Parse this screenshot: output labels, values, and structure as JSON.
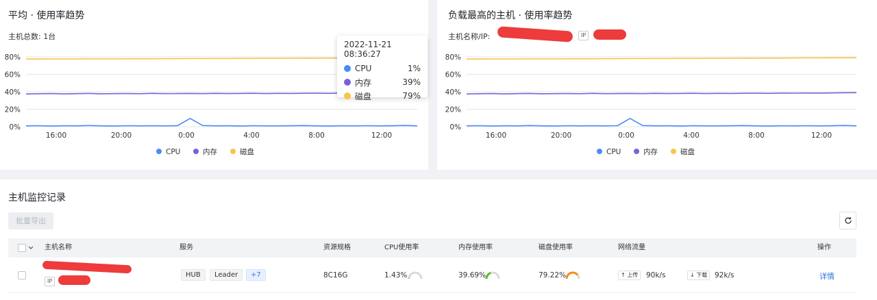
{
  "colors": {
    "cpu": "#4a8cf7",
    "mem": "#7b61d9",
    "disk": "#f7c548",
    "redaction": "#ee3b3b",
    "link": "#2f6fdf"
  },
  "chart_avg": {
    "title": "平均 · 使用率趋势",
    "subtitle_label": "主机总数:",
    "subtitle_value": "1台",
    "legend": [
      "CPU",
      "内存",
      "磁盘"
    ]
  },
  "chart_top": {
    "title": "负载最高的主机 · 使用率趋势",
    "subtitle_label": "主机名称/IP:",
    "ip_badge": "IP",
    "legend": [
      "CPU",
      "内存",
      "磁盘"
    ]
  },
  "tooltip": {
    "time": "2022-11-21 08:36:27",
    "rows": [
      {
        "name": "CPU",
        "value": "1%"
      },
      {
        "name": "内存",
        "value": "39%"
      },
      {
        "name": "磁盘",
        "value": "79%"
      }
    ]
  },
  "chart_data": [
    {
      "type": "line",
      "title": "平均 · 使用率趋势",
      "x_ticks": [
        "16:00",
        "20:00",
        "0:00",
        "4:00",
        "8:00",
        "12:00"
      ],
      "y_ticks": [
        "0%",
        "20%",
        "40%",
        "60%",
        "80%"
      ],
      "ylim": [
        0,
        80
      ],
      "grid": true,
      "legend_position": "bottom",
      "series": [
        {
          "name": "CPU",
          "values": [
            1,
            1.2,
            0.9,
            1.1,
            1,
            1.3,
            1,
            0.9,
            1.2,
            1,
            1.1,
            1,
            1.2,
            9.5,
            1.3,
            1,
            1.1,
            0.9,
            1.2,
            1,
            1,
            1.1,
            1.3,
            1,
            0.9,
            1.1,
            1,
            1.2,
            1,
            1.1,
            1.4,
            1
          ]
        },
        {
          "name": "内存",
          "values": [
            37.5,
            37.8,
            38,
            37.6,
            37.9,
            38.1,
            37.7,
            37.9,
            38,
            37.8,
            38.2,
            37.9,
            38,
            38.1,
            37.9,
            38.2,
            38,
            38.1,
            38.3,
            38,
            38.2,
            38.1,
            38.3,
            38.4,
            38.2,
            38.5,
            38.4,
            38.6,
            38.5,
            38.7,
            38.9,
            39
          ]
        },
        {
          "name": "磁盘",
          "values": [
            77.5,
            77.5,
            77.6,
            77.6,
            77.6,
            77.7,
            77.7,
            77.7,
            77.8,
            77.8,
            77.8,
            77.9,
            77.9,
            78,
            78,
            78.1,
            78.1,
            78.2,
            78.2,
            78.3,
            78.3,
            78.4,
            78.5,
            78.5,
            78.6,
            78.6,
            78.7,
            78.8,
            78.8,
            78.9,
            79,
            79
          ]
        }
      ]
    },
    {
      "type": "line",
      "title": "负载最高的主机 · 使用率趋势",
      "x_ticks": [
        "16:00",
        "20:00",
        "0:00",
        "4:00",
        "8:00",
        "12:00"
      ],
      "y_ticks": [
        "0%",
        "20%",
        "40%",
        "60%",
        "80%"
      ],
      "ylim": [
        0,
        80
      ],
      "grid": true,
      "legend_position": "bottom",
      "series": [
        {
          "name": "CPU",
          "values": [
            1,
            1.2,
            0.9,
            1.1,
            1,
            1.3,
            1,
            0.9,
            1.2,
            1,
            1.1,
            1,
            1.2,
            9.5,
            1.3,
            1,
            1.1,
            0.9,
            1.2,
            1,
            1,
            1.1,
            1.3,
            1,
            0.9,
            1.1,
            1,
            1.2,
            1,
            1.1,
            1.4,
            1
          ]
        },
        {
          "name": "内存",
          "values": [
            37.5,
            37.8,
            38,
            37.6,
            37.9,
            38.1,
            37.7,
            37.9,
            38,
            37.8,
            38.2,
            37.9,
            38,
            38.1,
            37.9,
            38.2,
            38,
            38.1,
            38.3,
            38,
            38.2,
            38.1,
            38.3,
            38.4,
            38.2,
            38.5,
            38.4,
            38.6,
            38.5,
            38.7,
            38.9,
            39
          ]
        },
        {
          "name": "磁盘",
          "values": [
            77.5,
            77.5,
            77.6,
            77.6,
            77.6,
            77.7,
            77.7,
            77.7,
            77.8,
            77.8,
            77.8,
            77.9,
            77.9,
            78,
            78,
            78.1,
            78.1,
            78.2,
            78.2,
            78.3,
            78.3,
            78.4,
            78.5,
            78.5,
            78.6,
            78.6,
            78.7,
            78.8,
            78.8,
            78.9,
            79,
            79
          ]
        }
      ]
    }
  ],
  "records": {
    "title": "主机监控记录",
    "export_button": "批量导出",
    "refresh_icon": "refresh-icon",
    "columns": [
      "主机名称",
      "服务",
      "资源规格",
      "CPU使用率",
      "内存使用率",
      "磁盘使用率",
      "网络流量",
      "操作"
    ],
    "rows": [
      {
        "ip_badge": "IP",
        "services": [
          "HUB",
          "Leader",
          "+7"
        ],
        "spec": "8C16G",
        "cpu": "1.43%",
        "cpu_pct": 1.43,
        "mem": "39.69%",
        "mem_pct": 39.69,
        "disk": "79.22%",
        "disk_pct": 79.22,
        "up_label": "↑ 上传",
        "up_value": "90k/s",
        "down_label": "↓ 下载",
        "down_value": "92k/s",
        "action": "详情"
      }
    ]
  }
}
